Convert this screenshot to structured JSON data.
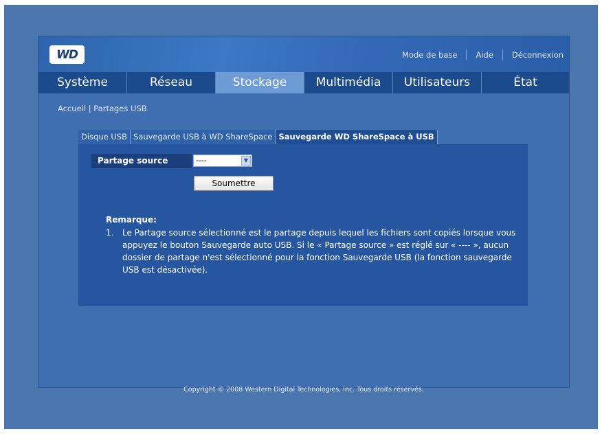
{
  "logo_text": "WD",
  "top_links": {
    "basic_mode": "Mode de base",
    "help": "Aide",
    "logout": "Déconnexion"
  },
  "nav": {
    "tabs": [
      "Système",
      "Réseau",
      "Stockage",
      "Multimédia",
      "Utilisateurs",
      "État"
    ],
    "active": "Stockage"
  },
  "breadcrumb": "Accueil | Partages USB",
  "subtabs": [
    "Disque USB",
    "Sauvegarde USB à WD ShareSpace",
    "Sauvegarde WD ShareSpace à USB"
  ],
  "form": {
    "source_label": "Partage source",
    "source_value": "----",
    "submit_label": "Soumettre"
  },
  "note": {
    "title": "Remarque:",
    "number": "1.",
    "text": "Le Partage source sélectionné est le partage depuis lequel les fichiers sont copiés lorsque vous appuyez le bouton Sauvegarde auto USB. Si le « Partage source » est réglé sur « ---- », aucun dossier de partage n'est sélectionné pour la fonction Sauvegarde USB (la fonction sauvegarde USB est désactivée)."
  },
  "footer": "Copyright © 2008 Western Digital Technologies, Inc. Tous droits réservés.",
  "colors": {
    "background": "#4a75ad",
    "nav": "#1c4b8d",
    "active_tab": "#6d9bd6",
    "panel": "#2656a0"
  }
}
